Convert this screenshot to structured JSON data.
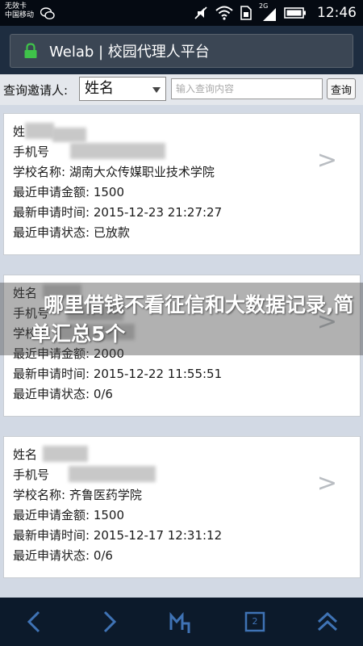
{
  "status_bar": {
    "carrier_line1": "无效卡",
    "carrier_line2": "中国移动",
    "network_label": "2G",
    "time": "12:46"
  },
  "app": {
    "title": "Welab | 校园代理人平台"
  },
  "search": {
    "label": "查询邀请人:",
    "select_value": "姓名",
    "input_placeholder": "输入查询内容",
    "button_label": "查询"
  },
  "records": [
    {
      "name_label": "姓",
      "phone_label": "手机号",
      "school": "学校名称: 湖南大众传媒职业技术学院",
      "amount": "最近申请金额: 1500",
      "time": "最新申请时间: 2015-12-23 21:27:27",
      "status": "最近申请状态: 已放款"
    },
    {
      "name_label": "姓名",
      "phone_label": "手机号",
      "school": "学校名",
      "amount": "最近申请金额: 2000",
      "time": "最新申请时间: 2015-12-22 11:55:51",
      "status": "最近申请状态: 0/6"
    },
    {
      "name_label": "姓名",
      "phone_label": "手机号",
      "school": "学校名称: 齐鲁医药学院",
      "amount": "最近申请金额: 1500",
      "time": "最新申请时间: 2015-12-17 12:31:12",
      "status": "最近申请状态: 0/6"
    }
  ],
  "record_chevron": ">",
  "overlay_caption": "哪里借钱不看征信和大数据记录,简单汇总5个",
  "bottom_nav": {
    "page_number": "2",
    "icons": [
      "back-icon",
      "forward-icon",
      "menu-m-icon",
      "tabs-icon",
      "collapse-up-icon"
    ]
  },
  "colors": {
    "status_bar_bg": "#050a12",
    "title_bar_bg": "#1e2d40",
    "lock_green": "#3fc34a",
    "list_bg": "#d2d9e4",
    "nav_icon": "#3f73b5"
  }
}
